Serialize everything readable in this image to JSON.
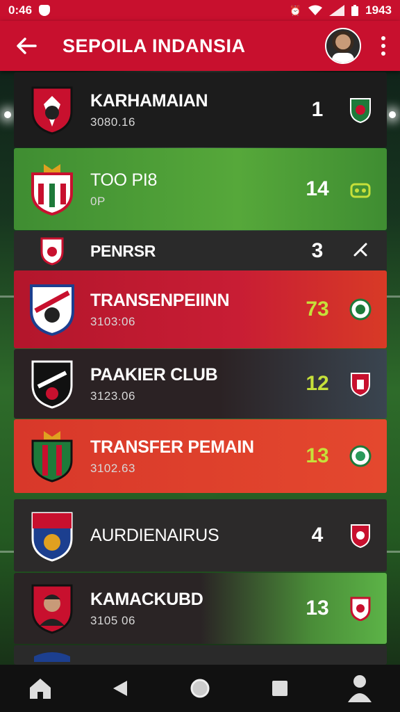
{
  "status_bar": {
    "time": "0:46",
    "battery": "1943"
  },
  "app_bar": {
    "title": "SEPOILA INDANSIA"
  },
  "icons": {
    "back": "arrow-left-icon",
    "more": "more-vertical-icon",
    "avatar": "user-avatar",
    "wifi": "wifi-icon",
    "signal": "signal-icon",
    "battery": "battery-icon",
    "alarm": "alarm-icon",
    "nav": [
      "home-icon",
      "back-triangle-icon",
      "circle-home-icon",
      "square-recents-icon",
      "profile-icon"
    ]
  },
  "colors": {
    "accent": "#c8102e",
    "score_highlight": "#c6e03a"
  },
  "matches": [
    {
      "name": "KARHAMAIAN",
      "date": "3080.16",
      "score": "1",
      "style": "dark",
      "score_color": "#ffffff"
    },
    {
      "name": "TOO PI8",
      "date": "0P",
      "score": "14",
      "style": "pitch",
      "score_color": "#ffffff"
    },
    {
      "name": "PENRSR",
      "date": "",
      "score": "3",
      "style": "dim",
      "score_color": "#ffffff"
    },
    {
      "name": "TRANSENPEIINN",
      "date": "3103:06",
      "score": "73",
      "style": "red",
      "score_color": "#c6e03a"
    },
    {
      "name": "PAAKIER CLUB",
      "date": "3123.06",
      "score": "12",
      "style": "slate",
      "score_color": "#c6e03a"
    },
    {
      "name": "TRANSFER PEMAIN",
      "date": "3102.63",
      "score": "13",
      "style": "orange",
      "score_color": "#c6e03a"
    },
    {
      "name": "AURDIENAIRUS",
      "date": "",
      "score": "4",
      "style": "charcoal",
      "score_color": "#ffffff"
    },
    {
      "name": "KAMACKUBD",
      "date": "3105 06",
      "score": "13",
      "style": "green",
      "score_color": "#ffffff"
    }
  ]
}
